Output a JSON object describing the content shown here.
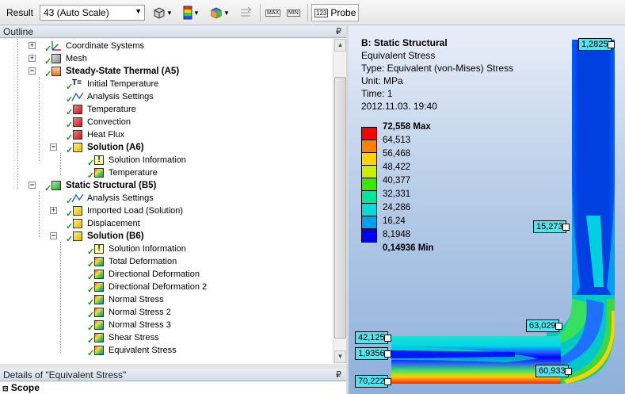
{
  "toolbar": {
    "result_label": "Result",
    "scale_value": "43 (Auto Scale)",
    "max_btn": "MAX",
    "min_btn": "MIN",
    "probe_icon_text": "123",
    "probe_label": "Probe"
  },
  "outline": {
    "title": "Outline",
    "pin": "₽",
    "nodes": {
      "coordinate_systems": "Coordinate Systems",
      "mesh": "Mesh",
      "steady_state_thermal": "Steady-State Thermal (A5)",
      "initial_temperature": "Initial Temperature",
      "analysis_settings_a": "Analysis Settings",
      "temperature": "Temperature",
      "convection": "Convection",
      "heat_flux": "Heat Flux",
      "solution_a6": "Solution (A6)",
      "solution_information_a": "Solution Information",
      "temperature_result": "Temperature",
      "static_structural": "Static Structural (B5)",
      "analysis_settings_b": "Analysis Settings",
      "imported_load": "Imported Load (Solution)",
      "displacement": "Displacement",
      "solution_b6": "Solution (B6)",
      "solution_information_b": "Solution Information",
      "total_deformation": "Total Deformation",
      "directional_deformation": "Directional Deformation",
      "directional_deformation_2": "Directional Deformation 2",
      "normal_stress": "Normal Stress",
      "normal_stress_2": "Normal Stress 2",
      "normal_stress_3": "Normal Stress 3",
      "shear_stress": "Shear Stress",
      "equivalent_stress": "Equivalent Stress"
    }
  },
  "details": {
    "title": "Details of \"Equivalent Stress\"",
    "pin": "₽",
    "scope": "Scope"
  },
  "graphics": {
    "title": "B: Static Structural",
    "lines": [
      "Equivalent Stress",
      "Type: Equivalent (von-Mises) Stress",
      "Unit: MPa",
      "Time: 1",
      "2012.11.03. 19:40"
    ],
    "legend": {
      "max_label": "72,558 Max",
      "min_label": "0,14936 Min",
      "levels": [
        "64,513",
        "56,468",
        "48,422",
        "40,377",
        "32,331",
        "24,286",
        "16,24",
        "8,1948"
      ],
      "colors": [
        "#ff0000",
        "#ff7f00",
        "#ffd200",
        "#c8f000",
        "#39e600",
        "#00e69a",
        "#00dcdc",
        "#00a0f0",
        "#0000ff"
      ]
    },
    "probes": {
      "top": "1,2825",
      "mid": "15,273",
      "elbow": "63,029",
      "left_top": "42,125",
      "left_mid": "1,9356",
      "left_bot": "70,222",
      "bottom": "60,933"
    }
  }
}
